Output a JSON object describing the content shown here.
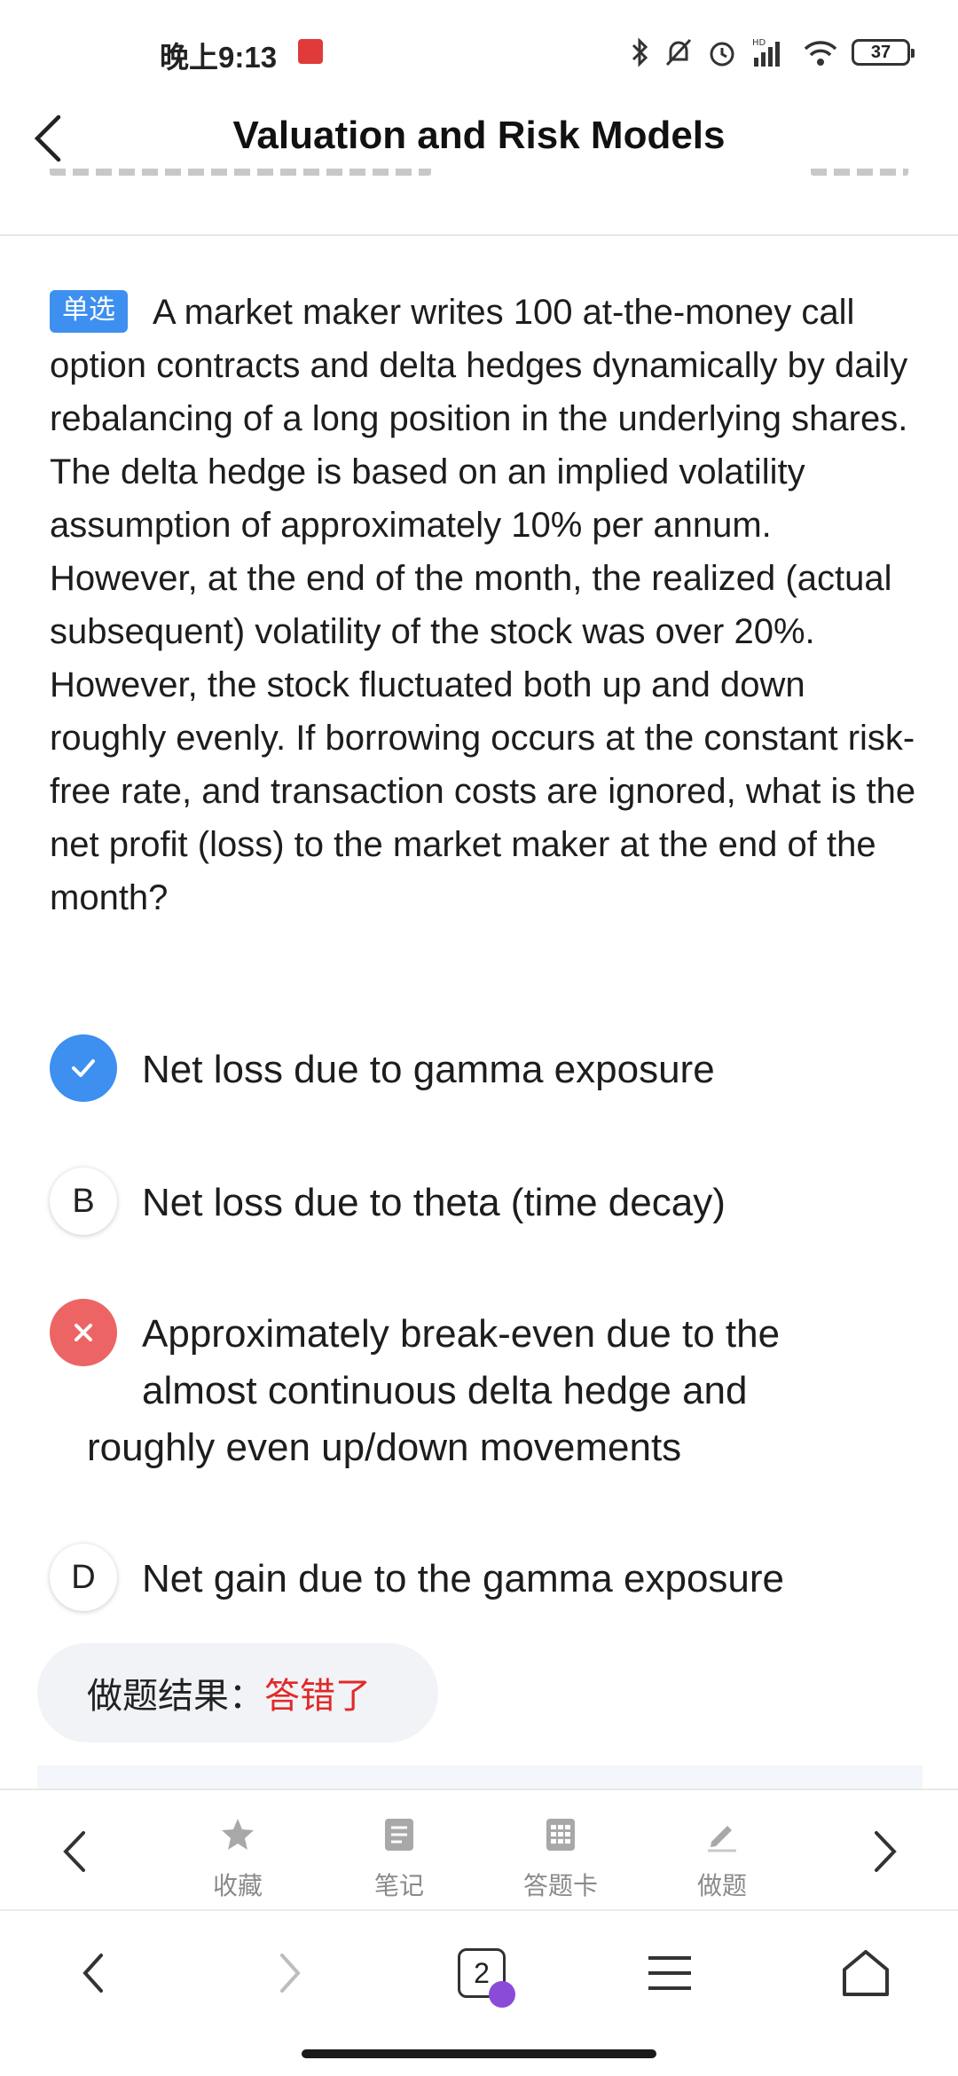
{
  "status_bar": {
    "time": "晚上9:13",
    "battery": "37"
  },
  "header": {
    "title": "Valuation and Risk Models"
  },
  "question": {
    "type_badge": "单选",
    "text": "A market maker writes 100 at-the-money call option contracts and delta hedges dynamically by daily rebalancing of a long position in the underlying shares. The delta hedge is based on an implied volatility assumption of approximately 10% per annum. However, at the end of the month, the realized (actual subsequent) volatility of the stock was over 20%. However, the stock fluctuated both up and down roughly evenly. If borrowing occurs at the constant risk-free rate, and transaction costs are ignored, what is the net profit (loss) to the market maker at the end of the month?"
  },
  "options": [
    {
      "marker": "",
      "state": "correct",
      "text": "Net loss due to gamma exposure"
    },
    {
      "marker": "B",
      "state": "neutral",
      "text": "Net loss due to theta (time decay)"
    },
    {
      "marker": "",
      "state": "wrong",
      "line1": "Approximately break-even due to the",
      "line2": "almost continuous delta hedge and",
      "line3": "roughly even up/down movements"
    },
    {
      "marker": "D",
      "state": "neutral",
      "text": "Net gain due to the gamma exposure"
    }
  ],
  "result": {
    "label": "做题结果：",
    "value": "答错了"
  },
  "toolbar": {
    "favorite": "收藏",
    "notes": "笔记",
    "answer_card": "答题卡",
    "practice": "做题"
  },
  "browser_nav": {
    "tab_count": "2"
  },
  "colors": {
    "accent": "#3d8ff0",
    "wrong": "#ec6464",
    "result_wrong_text": "#e02a2a"
  }
}
